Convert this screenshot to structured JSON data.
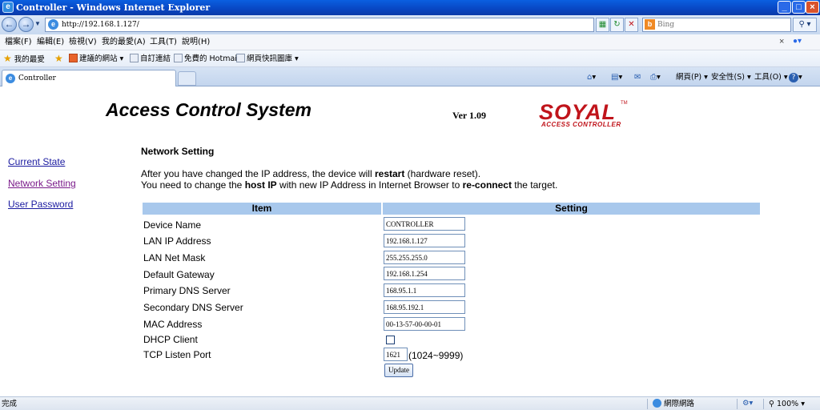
{
  "window": {
    "title": "Controller - Windows Internet Explorer"
  },
  "address_bar": {
    "url": "http://192.168.1.127/"
  },
  "search": {
    "placeholder": "Bing"
  },
  "menu": {
    "items": [
      "檔案(F)",
      "編輯(E)",
      "檢視(V)",
      "我的最愛(A)",
      "工具(T)",
      "說明(H)"
    ]
  },
  "favorites_bar": {
    "label": "我的最愛",
    "items": [
      "建議的網站 ▾",
      "自訂連結",
      "免費的 Hotmail",
      "網頁快訊圖庫 ▾"
    ]
  },
  "tab": {
    "label": "Controller"
  },
  "command_bar": {
    "page": "網頁(P) ▾",
    "safety": "安全性(S) ▾",
    "tools": "工具(O) ▾"
  },
  "header": {
    "title": "Access Control System",
    "version": "Ver 1.09",
    "logo_name": "SOYAL",
    "logo_tm": "TM",
    "logo_sub": "ACCESS CONTROLLER"
  },
  "sidebar": {
    "links": [
      "Current State",
      "Network Setting",
      "User Password"
    ]
  },
  "main": {
    "section_title": "Network Setting",
    "notice_line1": {
      "pre": "After you have changed the IP address, the device will ",
      "bold": "restart",
      "post": " (hardware reset)."
    },
    "notice_line2": {
      "pre": "You need to change the ",
      "bold1": "host IP",
      "mid": " with new IP Address in Internet Browser to ",
      "bold2": "re-connect",
      "post": " the target."
    },
    "table": {
      "col_item": "Item",
      "col_setting": "Setting",
      "rows": [
        {
          "label": "Device Name",
          "value": "CONTROLLER"
        },
        {
          "label": "LAN IP Address",
          "value": "192.168.1.127"
        },
        {
          "label": "LAN Net Mask",
          "value": "255.255.255.0"
        },
        {
          "label": "Default Gateway",
          "value": "192.168.1.254"
        },
        {
          "label": "Primary DNS Server",
          "value": "168.95.1.1"
        },
        {
          "label": "Secondary DNS Server",
          "value": "168.95.192.1"
        },
        {
          "label": "MAC Address",
          "value": "00-13-57-00-00-01"
        }
      ],
      "dhcp_label": "DHCP Client",
      "dhcp_checked": false,
      "port_label": "TCP Listen Port",
      "port_value": "1621",
      "port_range": "(1024~9999)",
      "update_label": "Update"
    }
  },
  "status_bar": {
    "text": "完成",
    "zone": "網際網路",
    "zoom": "100%"
  }
}
